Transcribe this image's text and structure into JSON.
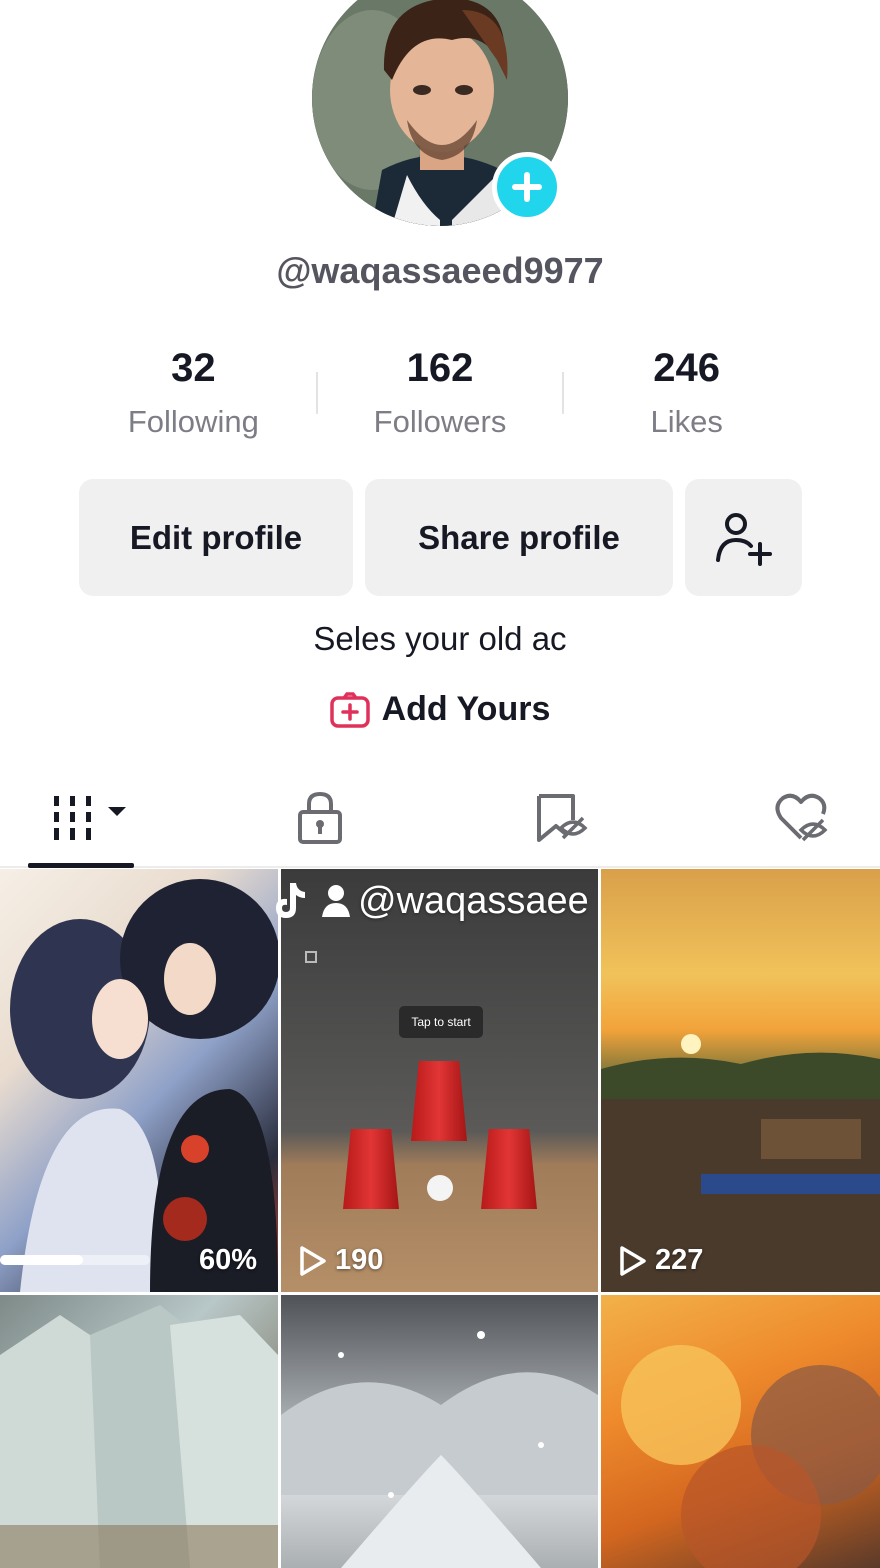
{
  "profile": {
    "username": "@waqassaeed9977",
    "bio": "Seles your old ac",
    "add_yours_label": "Add Yours"
  },
  "stats": [
    {
      "value": "32",
      "label": "Following"
    },
    {
      "value": "162",
      "label": "Followers"
    },
    {
      "value": "246",
      "label": "Likes"
    }
  ],
  "buttons": {
    "edit_label": "Edit profile",
    "share_label": "Share profile"
  },
  "tabs": [
    {
      "icon": "grid-videos-icon",
      "active": true
    },
    {
      "icon": "lock-icon",
      "active": false
    },
    {
      "icon": "bookmark-hidden-icon",
      "active": false
    },
    {
      "icon": "heart-hidden-icon",
      "active": false
    }
  ],
  "videos": [
    {
      "overlay": "60%",
      "progress": 0.55
    },
    {
      "views": "190",
      "tap_label": "Tap to start"
    },
    {
      "views": "227"
    },
    {},
    {},
    {
      "watermark": "@waqassaee"
    }
  ],
  "colors": {
    "accent_plus": "#20d5ec",
    "text_primary": "#161823",
    "text_secondary": "#7d7e85",
    "button_bg": "#f0f0f1",
    "add_yours_icon": "#e0315a"
  }
}
